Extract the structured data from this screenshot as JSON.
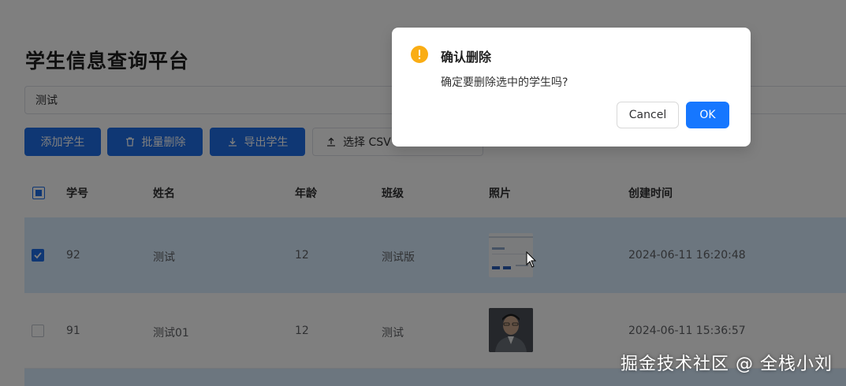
{
  "page": {
    "title": "学生信息查询平台"
  },
  "search": {
    "value": "测试"
  },
  "toolbar": {
    "add_label": "添加学生",
    "batch_delete_label": "批量删除",
    "export_label": "导出学生",
    "select_csv_label": "选择 CSV"
  },
  "table": {
    "columns": [
      "学号",
      "姓名",
      "年龄",
      "班级",
      "照片",
      "创建时间"
    ],
    "rows": [
      {
        "id": "92",
        "name": "测试",
        "age": "12",
        "class": "测试版",
        "created": "2024-06-11 16:20:48",
        "checked": true
      },
      {
        "id": "91",
        "name": "测试01",
        "age": "12",
        "class": "测试",
        "created": "2024-06-11 15:36:57",
        "checked": false
      }
    ]
  },
  "dialog": {
    "title": "确认删除",
    "message": "确定要删除选中的学生吗?",
    "cancel_label": "Cancel",
    "ok_label": "OK"
  },
  "watermark": "掘金技术社区 @ 全栈小刘",
  "colors": {
    "primary": "#1e6fe8",
    "ok_button": "#1677ff",
    "warning_icon": "#faad14",
    "selected_row": "#d9ecff"
  },
  "icons": {
    "warning": "exclamation-circle-icon",
    "delete": "trash-icon",
    "export": "download-icon",
    "upload": "upload-icon",
    "cursor": "mouse-pointer-icon"
  }
}
